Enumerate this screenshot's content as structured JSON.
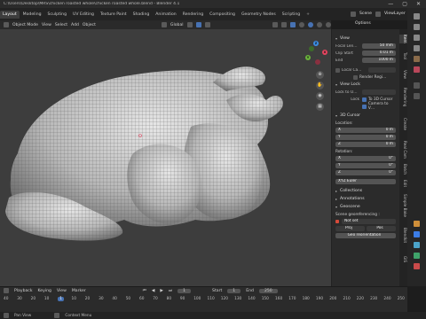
{
  "window": {
    "title": "C:\\Users\\Desktop\\MRS\\chicken roasted whole\\chicken roasted whole.blend - Blender 4.1",
    "controls": [
      "—",
      "▢",
      "✕"
    ]
  },
  "workspace_tabs": [
    "Layout",
    "Modeling",
    "Sculpting",
    "UV Editing",
    "Texture Paint",
    "Shading",
    "Animation",
    "Rendering",
    "Compositing",
    "Geometry Nodes",
    "Scripting",
    "+"
  ],
  "active_tab": "Layout",
  "scene": {
    "scene_name": "Scene",
    "view_layer": "ViewLayer"
  },
  "header": {
    "mode": "Object Mode",
    "menus": [
      "View",
      "Select",
      "Add",
      "Object"
    ],
    "transform": "Global",
    "options": "Options"
  },
  "npanel": {
    "view_section": "View",
    "focal_label": "Focal Len…",
    "focal_value": "50 mm",
    "clip_start_label": "Clip Start",
    "clip_start_value": "0.01 m",
    "end_label": "End",
    "end_value": "1000 m",
    "local_camera_label": "Local Ca…",
    "render_region_label": "Render Regi…",
    "view_lock_section": "View Lock",
    "lock_to_label": "Lock to O…",
    "lock_label": "Lock",
    "to_3d_cursor": "To 3D Cursor",
    "camera_to_view": "Camera to V…",
    "cursor_section": "3D Cursor",
    "location_label": "Location:",
    "loc_x_label": "X",
    "loc_x": "0 m",
    "loc_y_label": "Y",
    "loc_y": "0 m",
    "loc_z_label": "Z",
    "loc_z": "0 m",
    "rotation_label": "Rotation:",
    "rot_x_label": "X",
    "rot_x": "0°",
    "rot_y_label": "Y",
    "rot_y": "0°",
    "rot_z_label": "Z",
    "rot_z": "0°",
    "rot_mode": "XYZ Euler",
    "collections_section": "Collections",
    "annotations_section": "Annotations",
    "geoscene_section": "Geoscene",
    "georef_label": "Scene georeferencing :",
    "not_set": "Not set",
    "row_a": "Proj",
    "row_b": "Pos",
    "geo_button": "Geo reorientation"
  },
  "vertical_tabs": [
    "Item",
    "Tool",
    "View",
    "Rendering",
    "Create",
    "Real Cam",
    "Batch",
    "Edit",
    "Simple Bake",
    "Blendkit",
    "GIS"
  ],
  "timeline": {
    "menus": [
      "Playback",
      "Keying",
      "View",
      "Marker"
    ],
    "start_label": "Start",
    "start_value": "1",
    "end_label": "End",
    "end_value": "250",
    "current": "1",
    "frame_numbers": [
      "40",
      "30",
      "20",
      "10",
      "1",
      "10",
      "20",
      "30",
      "40",
      "50",
      "60",
      "70",
      "80",
      "90",
      "100",
      "110",
      "120",
      "130",
      "140",
      "150",
      "160",
      "170",
      "180",
      "190",
      "200",
      "210",
      "220",
      "230",
      "240",
      "250"
    ]
  },
  "status": {
    "pan": "Pan View",
    "context": "Context Menu"
  },
  "colors": {
    "accent": "#4772b3",
    "viewport_bg": "#3d3d3d",
    "mesh_light": "#d2d2d2",
    "x_axis": "#e64560",
    "y_axis": "#6ab33c",
    "z_axis": "#3c8ee6"
  }
}
